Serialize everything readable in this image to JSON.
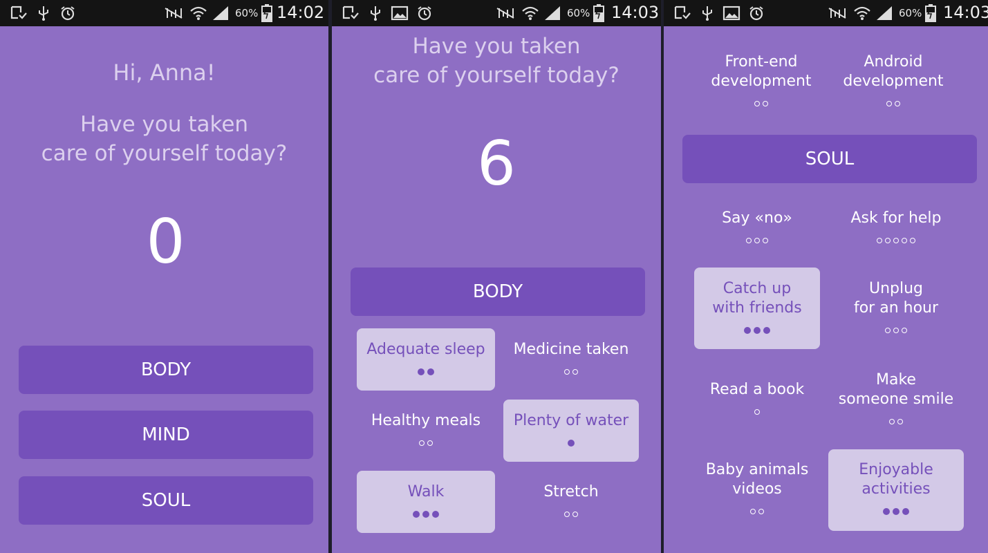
{
  "status_bars": [
    {
      "battery": "60%",
      "time": "14:02"
    },
    {
      "battery": "60%",
      "time": "14:03"
    },
    {
      "battery": "60%",
      "time": "14:03"
    }
  ],
  "screen1": {
    "greeting": "Hi, Anna!",
    "prompt_line1": "Have you taken",
    "prompt_line2": "care of yourself today?",
    "count": "0",
    "buttons": [
      "BODY",
      "MIND",
      "SOUL"
    ]
  },
  "screen2": {
    "prompt_line1": "Have you taken",
    "prompt_line2": "care of yourself today?",
    "count": "6",
    "category": "BODY",
    "items": [
      {
        "label": "Adequate sleep",
        "selected": true,
        "level": 2,
        "max": 2
      },
      {
        "label": "Medicine taken",
        "selected": false,
        "level": 0,
        "max": 2
      },
      {
        "label": "Healthy meals",
        "selected": false,
        "level": 0,
        "max": 2
      },
      {
        "label": "Plenty of water",
        "selected": true,
        "level": 1,
        "max": 1
      },
      {
        "label": "Walk",
        "selected": true,
        "level": 3,
        "max": 3
      },
      {
        "label": "Stretch",
        "selected": false,
        "level": 0,
        "max": 2
      }
    ]
  },
  "screen3": {
    "top_items": [
      {
        "label": "Front-end\ndevelopment",
        "selected": false,
        "level": 0,
        "max": 2
      },
      {
        "label": "Android\ndevelopment",
        "selected": false,
        "level": 0,
        "max": 2
      }
    ],
    "category": "SOUL",
    "items": [
      {
        "label": "Say «no»",
        "selected": false,
        "level": 0,
        "max": 3
      },
      {
        "label": "Ask for help",
        "selected": false,
        "level": 0,
        "max": 5
      },
      {
        "label": "Catch up\nwith friends",
        "selected": true,
        "level": 3,
        "max": 3
      },
      {
        "label": "Unplug\nfor an hour",
        "selected": false,
        "level": 0,
        "max": 3
      },
      {
        "label": "Read a book",
        "selected": false,
        "level": 0,
        "max": 1
      },
      {
        "label": "Make\nsomeone smile",
        "selected": false,
        "level": 0,
        "max": 2
      },
      {
        "label": "Baby animals\nvideos",
        "selected": false,
        "level": 0,
        "max": 2
      },
      {
        "label": "Enjoyable\nactivities",
        "selected": true,
        "level": 3,
        "max": 3
      }
    ]
  },
  "colors": {
    "background": "#8e6ec4",
    "button": "#7550ba",
    "selected_tile": "#d3c9e7",
    "text_light": "#dcd0ee"
  }
}
